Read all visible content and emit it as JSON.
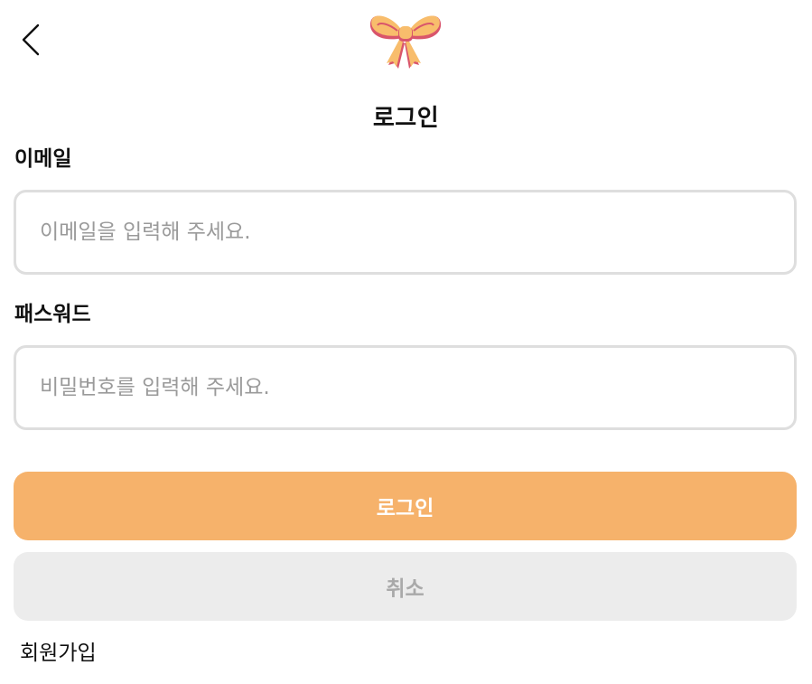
{
  "header": {
    "back_icon": "chevron-left-icon",
    "logo_icon": "ribbon-bow-icon"
  },
  "title": "로그인",
  "form": {
    "email": {
      "label": "이메일",
      "placeholder": "이메일을 입력해 주세요.",
      "value": ""
    },
    "password": {
      "label": "패스워드",
      "placeholder": "비밀번호를 입력해 주세요.",
      "value": ""
    }
  },
  "buttons": {
    "login_label": "로그인",
    "cancel_label": "취소"
  },
  "links": {
    "signup_label": "회원가입"
  },
  "colors": {
    "accent": "#f6b26b",
    "cancel_bg": "#ececec",
    "cancel_text": "#a9a9a9",
    "input_border": "#dedede",
    "bow_main": "#f8bd6c",
    "bow_shadow": "#d9556b"
  }
}
